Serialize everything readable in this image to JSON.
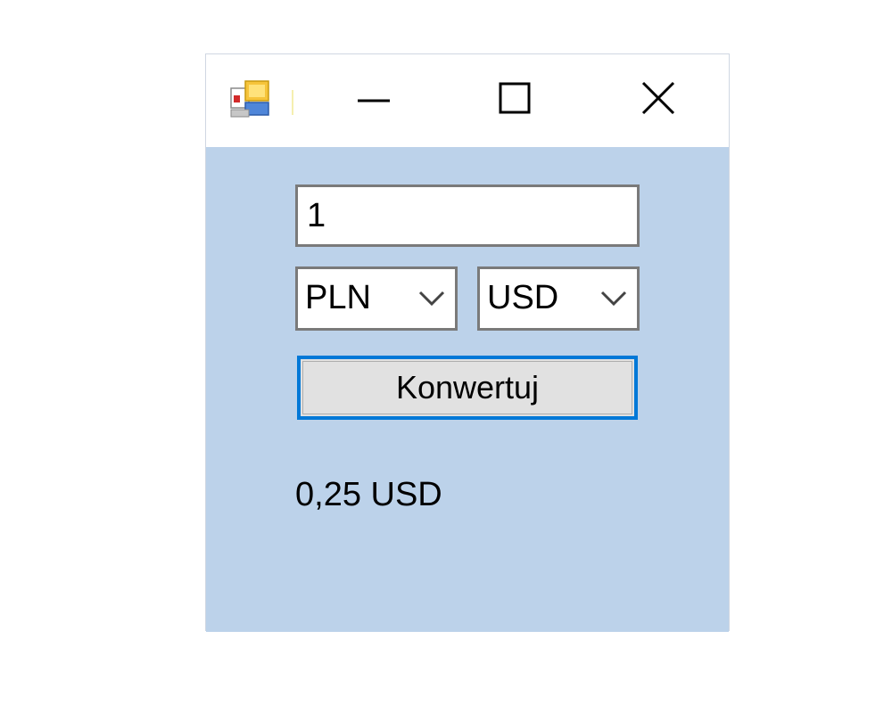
{
  "window": {
    "title": "",
    "background_color": "#bcd2ea",
    "icons": {
      "app": "app-icon",
      "minimize": "minimize-icon",
      "maximize": "maximize-icon",
      "close": "close-icon"
    }
  },
  "form": {
    "amount_value": "1",
    "from_currency": {
      "selected": "PLN",
      "icon": "chevron-down-icon"
    },
    "to_currency": {
      "selected": "USD",
      "icon": "chevron-down-icon"
    },
    "convert_label": "Konwertuj",
    "result_text": "0,25 USD"
  },
  "colors": {
    "focus_border": "#0078d7",
    "button_face": "#e1e1e1"
  }
}
